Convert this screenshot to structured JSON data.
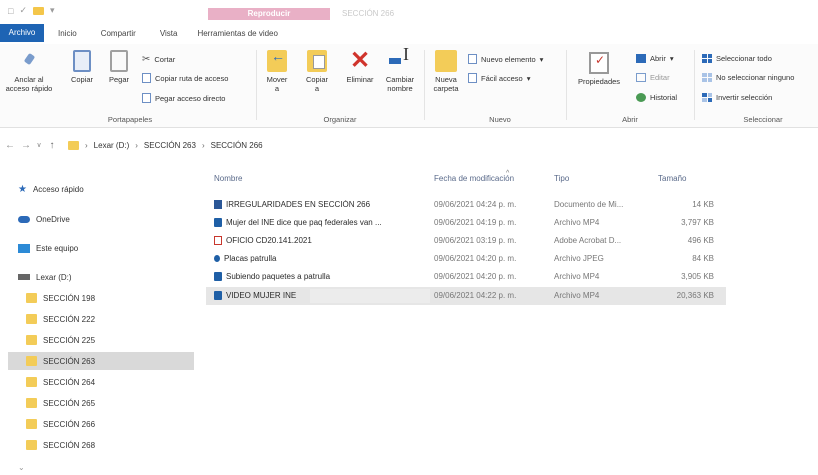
{
  "titlebar": {
    "context_tab": "Reproducir",
    "window_title": "SECCIÓN 266"
  },
  "tabs": {
    "archivo": "Archivo",
    "inicio": "Inicio",
    "compartir": "Compartir",
    "vista": "Vista",
    "herramientas": "Herramientas de video"
  },
  "ribbon": {
    "portapapeles": {
      "anclar": [
        "Anclar al",
        "acceso rápido"
      ],
      "copiar": "Copiar",
      "pegar": "Pegar",
      "cortar": "Cortar",
      "copiar_ruta": "Copiar ruta de acceso",
      "pegar_acceso": "Pegar acceso directo",
      "label": "Portapapeles"
    },
    "organizar": {
      "mover": [
        "Mover",
        "a"
      ],
      "copiar_en": [
        "Copiar",
        "a"
      ],
      "eliminar": "Eliminar",
      "cambiar_nombre": [
        "Cambiar",
        "nombre"
      ],
      "label": "Organizar"
    },
    "nuevo": {
      "nueva_carpeta": [
        "Nueva",
        "carpeta"
      ],
      "nuevo_elemento": "Nuevo elemento",
      "facil_acceso": "Fácil acceso",
      "label": "Nuevo"
    },
    "abrir": {
      "propiedades": "Propiedades",
      "abrir": "Abrir",
      "editar": "Editar",
      "historial": "Historial",
      "label": "Abrir"
    },
    "seleccionar": {
      "todo": "Seleccionar todo",
      "ninguno": "No seleccionar ninguno",
      "invertir": "Invertir selección",
      "label": "Seleccionar"
    }
  },
  "address": {
    "drive": "Lexar (D:)",
    "parent": "SECCIÓN 263",
    "current": "SECCIÓN 266"
  },
  "navpane": {
    "acceso_rapido": "Acceso rápido",
    "onedrive": "OneDrive",
    "este_equipo": "Este equipo",
    "drive": "Lexar (D:)",
    "folders": [
      "SECCIÓN 198",
      "SECCIÓN 222",
      "SECCIÓN 225",
      "SECCIÓN 263",
      "SECCIÓN 264",
      "SECCIÓN 265",
      "SECCIÓN 266",
      "SECCIÓN 268"
    ],
    "selected_index": 3
  },
  "filelist": {
    "columns": {
      "name": "Nombre",
      "date": "Fecha de modificación",
      "type": "Tipo",
      "size": "Tamaño"
    },
    "rows": [
      {
        "name": "IRREGULARIDADES EN SECCIÓN 266",
        "date": "09/06/2021 04:24 p. m.",
        "type": "Documento de Mi...",
        "size": "14 KB",
        "icon": "word"
      },
      {
        "name": "Mujer del INE dice que paq federales van ...",
        "date": "09/06/2021 04:19 p. m.",
        "type": "Archivo MP4",
        "size": "3,797 KB",
        "icon": "mp4"
      },
      {
        "name": "OFICIO CD20.141.2021",
        "date": "09/06/2021 03:19 p. m.",
        "type": "Adobe Acrobat D...",
        "size": "496 KB",
        "icon": "pdf"
      },
      {
        "name": "Placas patrulla",
        "date": "09/06/2021 04:20 p. m.",
        "type": "Archivo JPEG",
        "size": "84 KB",
        "icon": "jpg"
      },
      {
        "name": "Subiendo paquetes a patrulla",
        "date": "09/06/2021 04:20 p. m.",
        "type": "Archivo MP4",
        "size": "3,905 KB",
        "icon": "mp4"
      },
      {
        "name": "VIDEO MUJER INE",
        "date": "09/06/2021 04:22 p. m.",
        "type": "Archivo MP4",
        "size": "20,363 KB",
        "icon": "mp4"
      }
    ],
    "selected_index": 5
  }
}
